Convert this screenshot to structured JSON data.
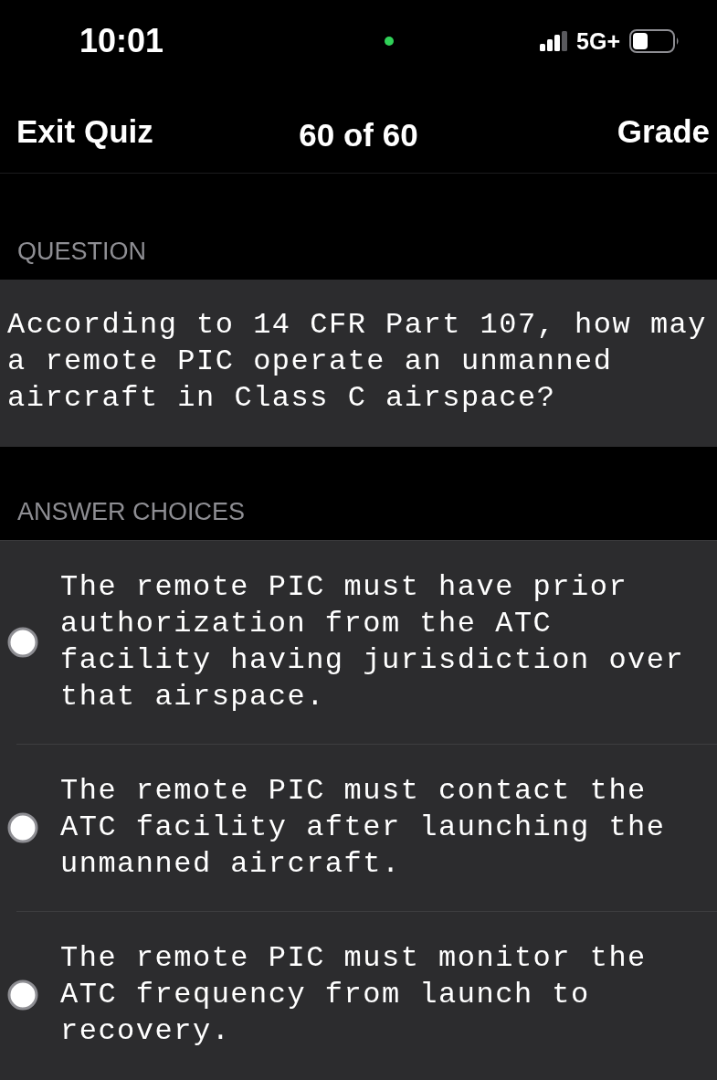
{
  "status_bar": {
    "time": "10:01",
    "network": "5G+"
  },
  "nav": {
    "left_action": "Exit Quiz",
    "title": "60 of 60",
    "right_action": "Grade"
  },
  "question": {
    "header": "QUESTION",
    "text": "According to 14 CFR Part 107, how may a remote PIC operate an unmanned aircraft in Class C airspace?"
  },
  "answers": {
    "header": "ANSWER CHOICES",
    "choices": [
      {
        "text": "The remote PIC must have prior authorization from the ATC facility having jurisdiction over that airspace.",
        "selected": false
      },
      {
        "text": "The remote PIC must contact the ATC facility after launching the unmanned aircraft.",
        "selected": false
      },
      {
        "text": "The remote PIC must monitor the ATC frequency from launch to recovery.",
        "selected": false
      }
    ]
  }
}
